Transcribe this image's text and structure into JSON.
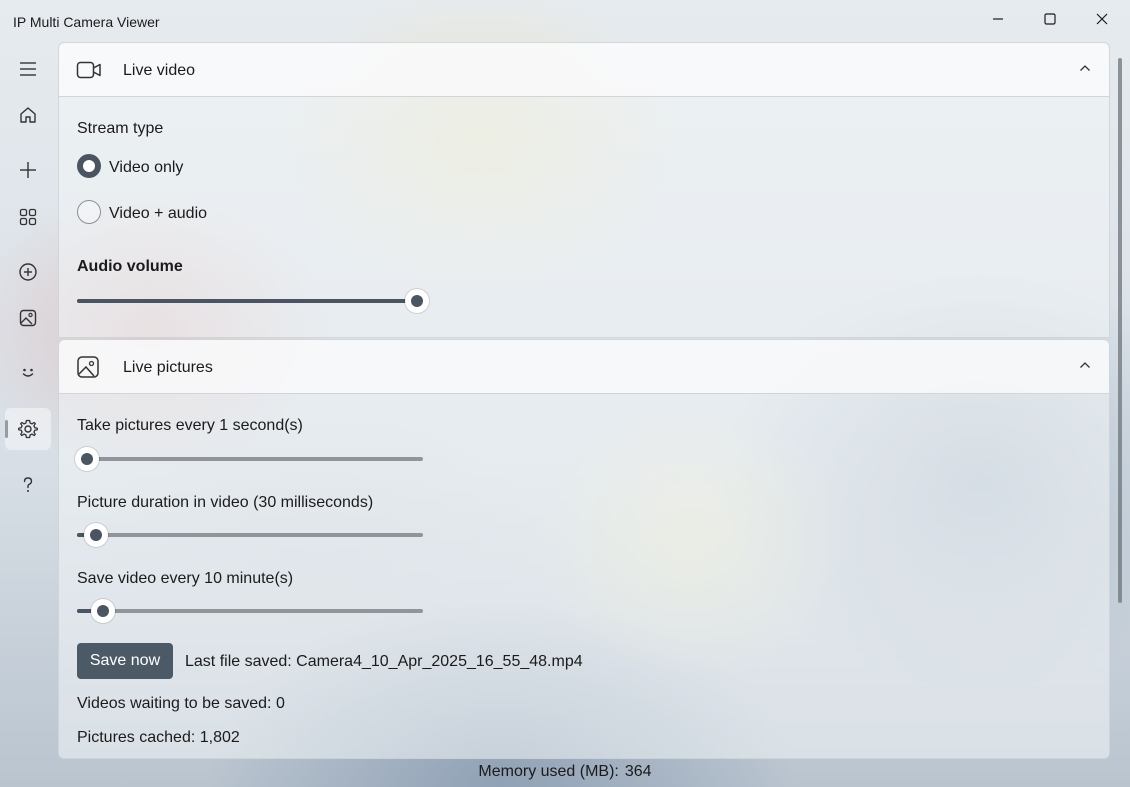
{
  "window": {
    "title": "IP Multi Camera Viewer",
    "controls": {
      "minimize": "minimize-icon",
      "maximize": "maximize-icon",
      "close": "close-icon"
    }
  },
  "navrail": {
    "items": [
      {
        "name": "menu",
        "icon": "hamburger-icon"
      },
      {
        "name": "home",
        "icon": "home-icon"
      },
      {
        "name": "add",
        "icon": "plus-icon"
      },
      {
        "name": "grid",
        "icon": "grid-icon"
      },
      {
        "name": "add-camera",
        "icon": "circle-plus-icon"
      },
      {
        "name": "pictures",
        "icon": "picture-icon"
      },
      {
        "name": "feedback",
        "icon": "smiley-icon"
      },
      {
        "name": "settings",
        "icon": "gear-icon",
        "selected": true
      },
      {
        "name": "help",
        "icon": "question-icon"
      }
    ]
  },
  "live_video": {
    "title": "Live video",
    "icon": "video-camera-icon",
    "stream_type_label": "Stream type",
    "options": [
      "Video only",
      "Video + audio"
    ],
    "selected_option": "Video only",
    "audio_volume_label": "Audio volume",
    "audio_volume_fraction": 0.97
  },
  "live_pictures": {
    "title": "Live pictures",
    "icon": "picture-icon",
    "take_pictures_label": "Take pictures every 1 second(s)",
    "take_pictures_fraction": 0.03,
    "picture_duration_label": "Picture duration in video (30 milliseconds)",
    "picture_duration_fraction": 0.055,
    "save_video_label": "Save video every 10 minute(s)",
    "save_video_fraction": 0.075,
    "save_button": "Save now",
    "last_file_saved": "Last file saved: Camera4_10_Apr_2025_16_55_48.mp4",
    "videos_waiting": "Videos waiting to be saved: 0",
    "pictures_cached": "Pictures cached: 1,802"
  },
  "status": {
    "memory_label": "Memory used (MB):",
    "memory_value": "364"
  },
  "colors": {
    "accent": "#4a5561",
    "button": "#4c5966"
  }
}
